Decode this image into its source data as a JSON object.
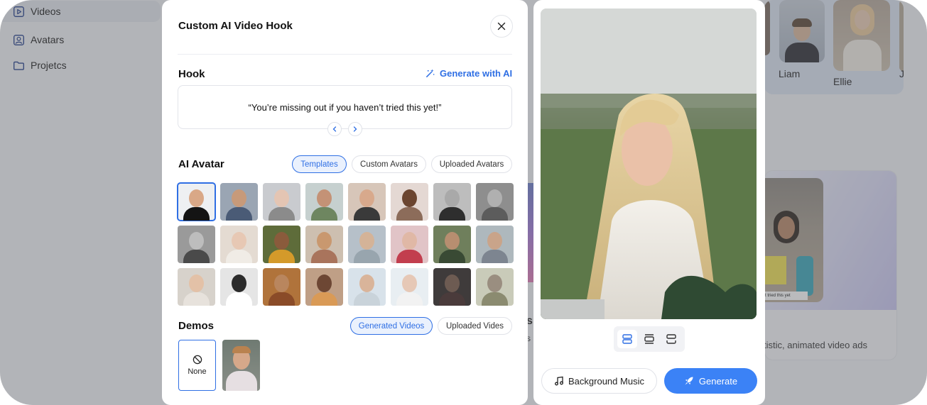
{
  "sidebar": {
    "items": [
      {
        "label": "Videos",
        "icon": "play-square-icon"
      },
      {
        "label": "Avatars",
        "icon": "user-square-icon"
      },
      {
        "label": "Projetcs",
        "icon": "folder-icon"
      }
    ]
  },
  "background": {
    "avatar_names": [
      "Liam",
      "Ellie",
      "J"
    ],
    "ad_description": "tistic, animated video ads",
    "ad_caption": "t tried this yet",
    "partial_letter": "s",
    "partial_letter2": "s"
  },
  "modal": {
    "title": "Custom AI Video Hook",
    "hook": {
      "title": "Hook",
      "generate_label": "Generate with AI",
      "text": "“You’re missing out if you haven’t tried this yet!”"
    },
    "ai_avatar": {
      "title": "AI Avatar",
      "tabs": [
        "Templates",
        "Custom Avatars",
        "Uploaded Avatars"
      ],
      "active_tab": "Templates",
      "tile_count": 24,
      "selected_index": 0
    },
    "demos": {
      "title": "Demos",
      "tabs": [
        "Generated Videos",
        "Uploaded Vides"
      ],
      "active_tab": "Generated Videos",
      "none_label": "None"
    }
  },
  "preview": {
    "layout_options": [
      "layout-top-icon",
      "layout-center-icon",
      "layout-split-icon"
    ],
    "active_layout": 0,
    "music_label": "Background Music",
    "generate_label": "Generate"
  },
  "colors": {
    "accent": "#2f6fe4",
    "generate": "#3b82f6"
  }
}
